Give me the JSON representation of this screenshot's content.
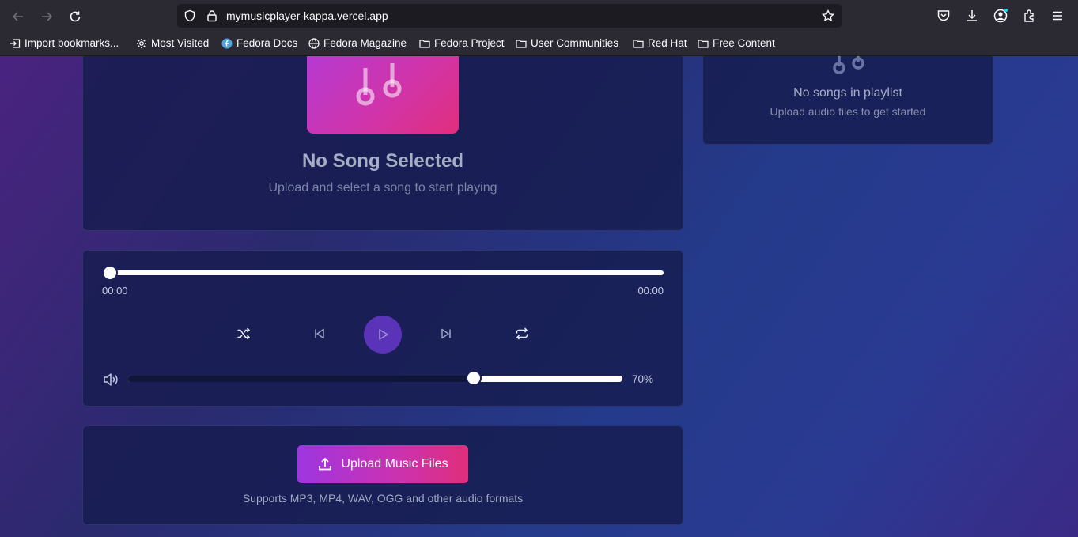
{
  "browser": {
    "url": "mymusicplayer-kappa.vercel.app",
    "bookmarks": [
      {
        "label": "Import bookmarks...",
        "icon": "import-icon"
      },
      {
        "label": "Most Visited",
        "icon": "gear-icon"
      },
      {
        "label": "Fedora Docs",
        "icon": "fedora-icon"
      },
      {
        "label": "Fedora Magazine",
        "icon": "globe-icon"
      },
      {
        "label": "Fedora Project",
        "icon": "folder-icon"
      },
      {
        "label": "User Communities",
        "icon": "folder-icon"
      },
      {
        "label": "Red Hat",
        "icon": "folder-icon"
      },
      {
        "label": "Free Content",
        "icon": "folder-icon"
      }
    ]
  },
  "now_playing": {
    "title": "No Song Selected",
    "subtitle": "Upload and select a song to start playing"
  },
  "player": {
    "current_time": "00:00",
    "duration": "00:00",
    "progress": 0,
    "volume": 0.7,
    "volume_label": "70%"
  },
  "upload": {
    "button_label": "Upload Music Files",
    "hint": "Supports MP3, MP4, WAV, OGG and other audio formats"
  },
  "playlist": {
    "empty_title": "No songs in playlist",
    "empty_subtitle": "Upload audio files to get started"
  },
  "colors": {
    "accent": "#5b33b8",
    "upload_gradient_start": "#9d36e0",
    "upload_gradient_end": "#e02e7c"
  }
}
